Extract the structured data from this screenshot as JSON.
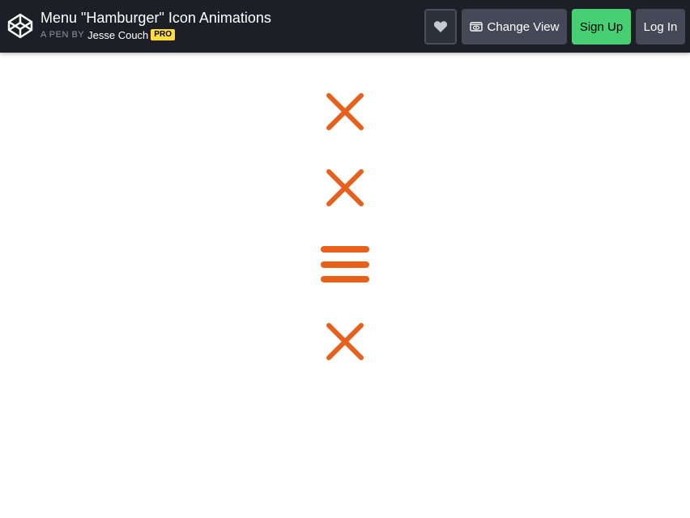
{
  "header": {
    "title": "Menu \"Hamburger\" Icon Animations",
    "byline_prefix": "A PEN BY",
    "author": "Jesse Couch",
    "badge": "PRO",
    "heart_icon": "heart-icon",
    "change_view_label": "Change View",
    "change_view_icon": "eye-icon",
    "signup_label": "Sign Up",
    "login_label": "Log In"
  },
  "stage": {
    "icons": [
      {
        "state": "close",
        "icon": "close-icon"
      },
      {
        "state": "close",
        "icon": "close-icon"
      },
      {
        "state": "hamburger",
        "icon": "hamburger-icon"
      },
      {
        "state": "close",
        "icon": "close-icon"
      }
    ]
  },
  "colors": {
    "topbar": "#1e1f26",
    "accent": "#e8611c",
    "signup": "#47cf73",
    "button": "#444857",
    "badge": "#ffdd40"
  }
}
